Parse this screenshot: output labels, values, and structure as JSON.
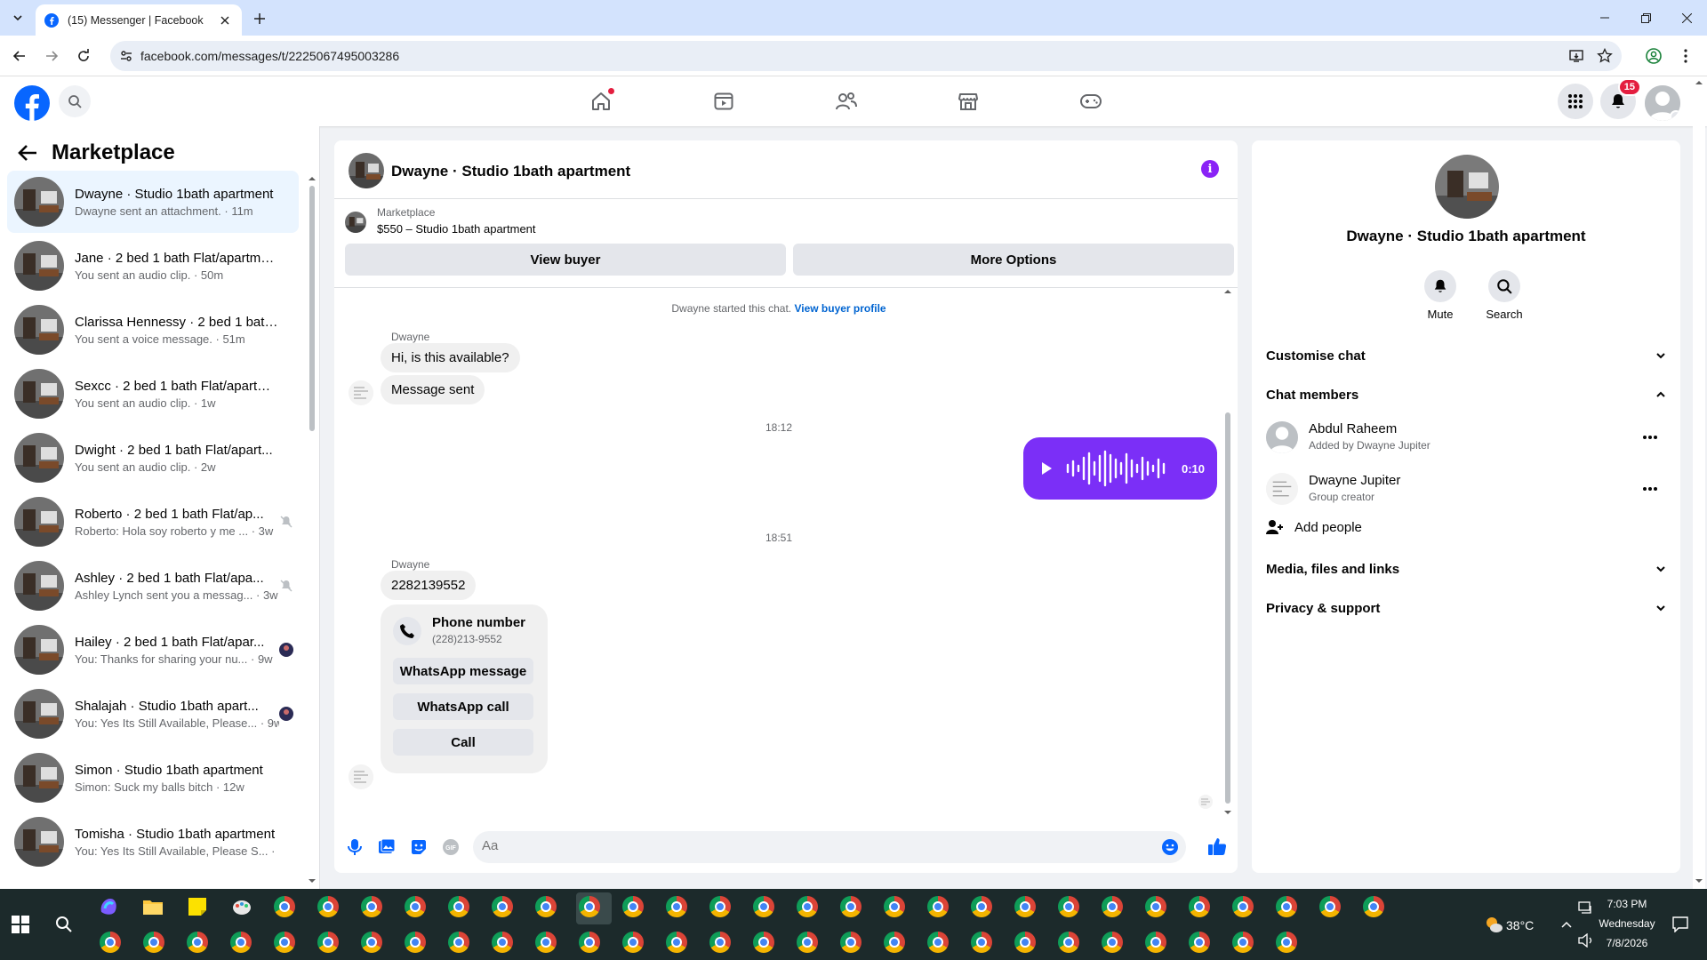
{
  "browser": {
    "tab_title": "(15) Messenger | Facebook",
    "url": "facebook.com/messages/t/2225067495003286"
  },
  "fb_header": {
    "notification_count": "15"
  },
  "left_panel": {
    "title": "Marketplace",
    "conversations": [
      {
        "name": "Dwayne · Studio 1bath apartment",
        "preview": "Dwayne sent an attachment. · 11m",
        "active": true
      },
      {
        "name": "Jane · 2 bed 1 bath Flat/apartment",
        "preview": "You sent an audio clip. · 50m"
      },
      {
        "name": "Clarissa Hennessy · 2 bed 1 bath ...",
        "preview": "You sent a voice message. · 51m"
      },
      {
        "name": "Sexcc · 2 bed 1 bath Flat/apartm...",
        "preview": "You sent an audio clip. · 1w"
      },
      {
        "name": "Dwight · 2 bed 1 bath Flat/apart...",
        "preview": "You sent an audio clip. · 2w"
      },
      {
        "name": "Roberto · 2 bed 1 bath Flat/ap...",
        "preview": "Roberto: Hola soy roberto y me ... · 3w",
        "right": "muted-icon"
      },
      {
        "name": "Ashley · 2 bed 1 bath Flat/apa...",
        "preview": "Ashley Lynch sent you a messag... · 3w",
        "right": "muted-icon"
      },
      {
        "name": "Hailey · 2 bed 1 bath Flat/apar...",
        "preview": "You: Thanks for sharing your nu... · 9w",
        "right": "seen-avatar"
      },
      {
        "name": "Shalajah · Studio 1bath apart...",
        "preview": "You: Yes Its Still Available, Please... · 9w",
        "right": "seen-avatar"
      },
      {
        "name": "Simon · Studio 1bath apartment",
        "preview": "Simon: Suck my balls bitch · 12w"
      },
      {
        "name": "Tomisha · Studio 1bath apartment",
        "preview": "You: Yes Its Still Available, Please S... · 13w"
      }
    ]
  },
  "chat": {
    "title": "Dwayne · Studio 1bath apartment",
    "marketplace_label": "Marketplace",
    "listing": "$550 – Studio 1bath apartment",
    "view_buyer": "View buyer",
    "more_options": "More Options",
    "system_text": "Dwayne started this chat.",
    "system_link": "View buyer profile",
    "sender1": "Dwayne",
    "msg1": "Hi, is this available?",
    "msg2": "Message sent",
    "time1": "18:12",
    "voice_duration": "0:10",
    "time2": "18:51",
    "sender2": "Dwayne",
    "msg3": "2282139552",
    "phone_card": {
      "title": "Phone number",
      "number": "(228)213-9552",
      "buttons": [
        "WhatsApp message",
        "WhatsApp call",
        "Call"
      ]
    },
    "composer_placeholder": "Aa"
  },
  "info_panel": {
    "name": "Dwayne · Studio 1bath apartment",
    "actions": [
      "Mute",
      "Search"
    ],
    "customise": "Customise chat",
    "members_heading": "Chat members",
    "members": [
      {
        "name": "Abdul Raheem",
        "sub": "Added by Dwayne Jupiter"
      },
      {
        "name": "Dwayne Jupiter",
        "sub": "Group creator"
      }
    ],
    "add_people": "Add people",
    "media": "Media, files and links",
    "privacy": "Privacy & support"
  },
  "taskbar": {
    "temperature": "38°C",
    "time": "7:03 PM",
    "day": "Wednesday",
    "date": "7/8/2026"
  },
  "colors": {
    "fb_blue": "#0866ff",
    "accent_purple": "#7b2ff7",
    "active_row": "#ebf5ff"
  }
}
